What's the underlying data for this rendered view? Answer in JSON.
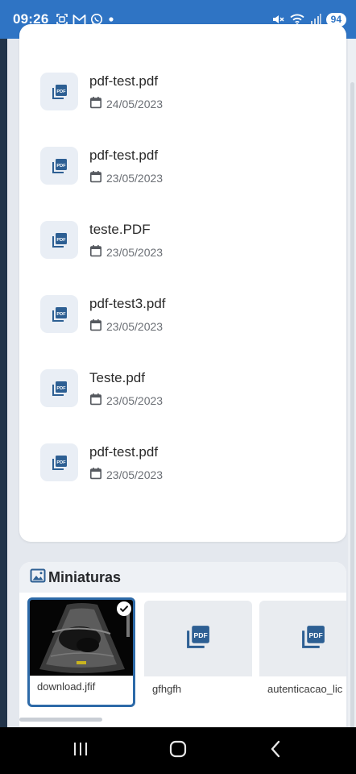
{
  "status_bar": {
    "time": "09:26",
    "notification_icons": [
      "screenshot-icon",
      "gmail-icon",
      "whatsapp-icon",
      "dot-icon"
    ],
    "battery": "94"
  },
  "files": [
    {
      "name": "pdf-test.pdf",
      "date": "24/05/2023"
    },
    {
      "name": "pdf-test.pdf",
      "date": "23/05/2023"
    },
    {
      "name": "teste.PDF",
      "date": "23/05/2023"
    },
    {
      "name": "pdf-test3.pdf",
      "date": "23/05/2023"
    },
    {
      "name": "Teste.pdf",
      "date": "23/05/2023"
    },
    {
      "name": "pdf-test.pdf",
      "date": "23/05/2023"
    }
  ],
  "thumbnails": {
    "title": "Miniaturas",
    "items": [
      {
        "caption": "download.jfif",
        "selected": true,
        "kind": "image"
      },
      {
        "caption": "gfhgfh",
        "selected": false,
        "kind": "pdf"
      },
      {
        "caption": "autenticacao_lic",
        "selected": false,
        "kind": "pdf"
      }
    ]
  },
  "colors": {
    "status_bar": "#2f74c4",
    "accent": "#2d6aa8",
    "pdf_icon": "#2d5f93"
  }
}
